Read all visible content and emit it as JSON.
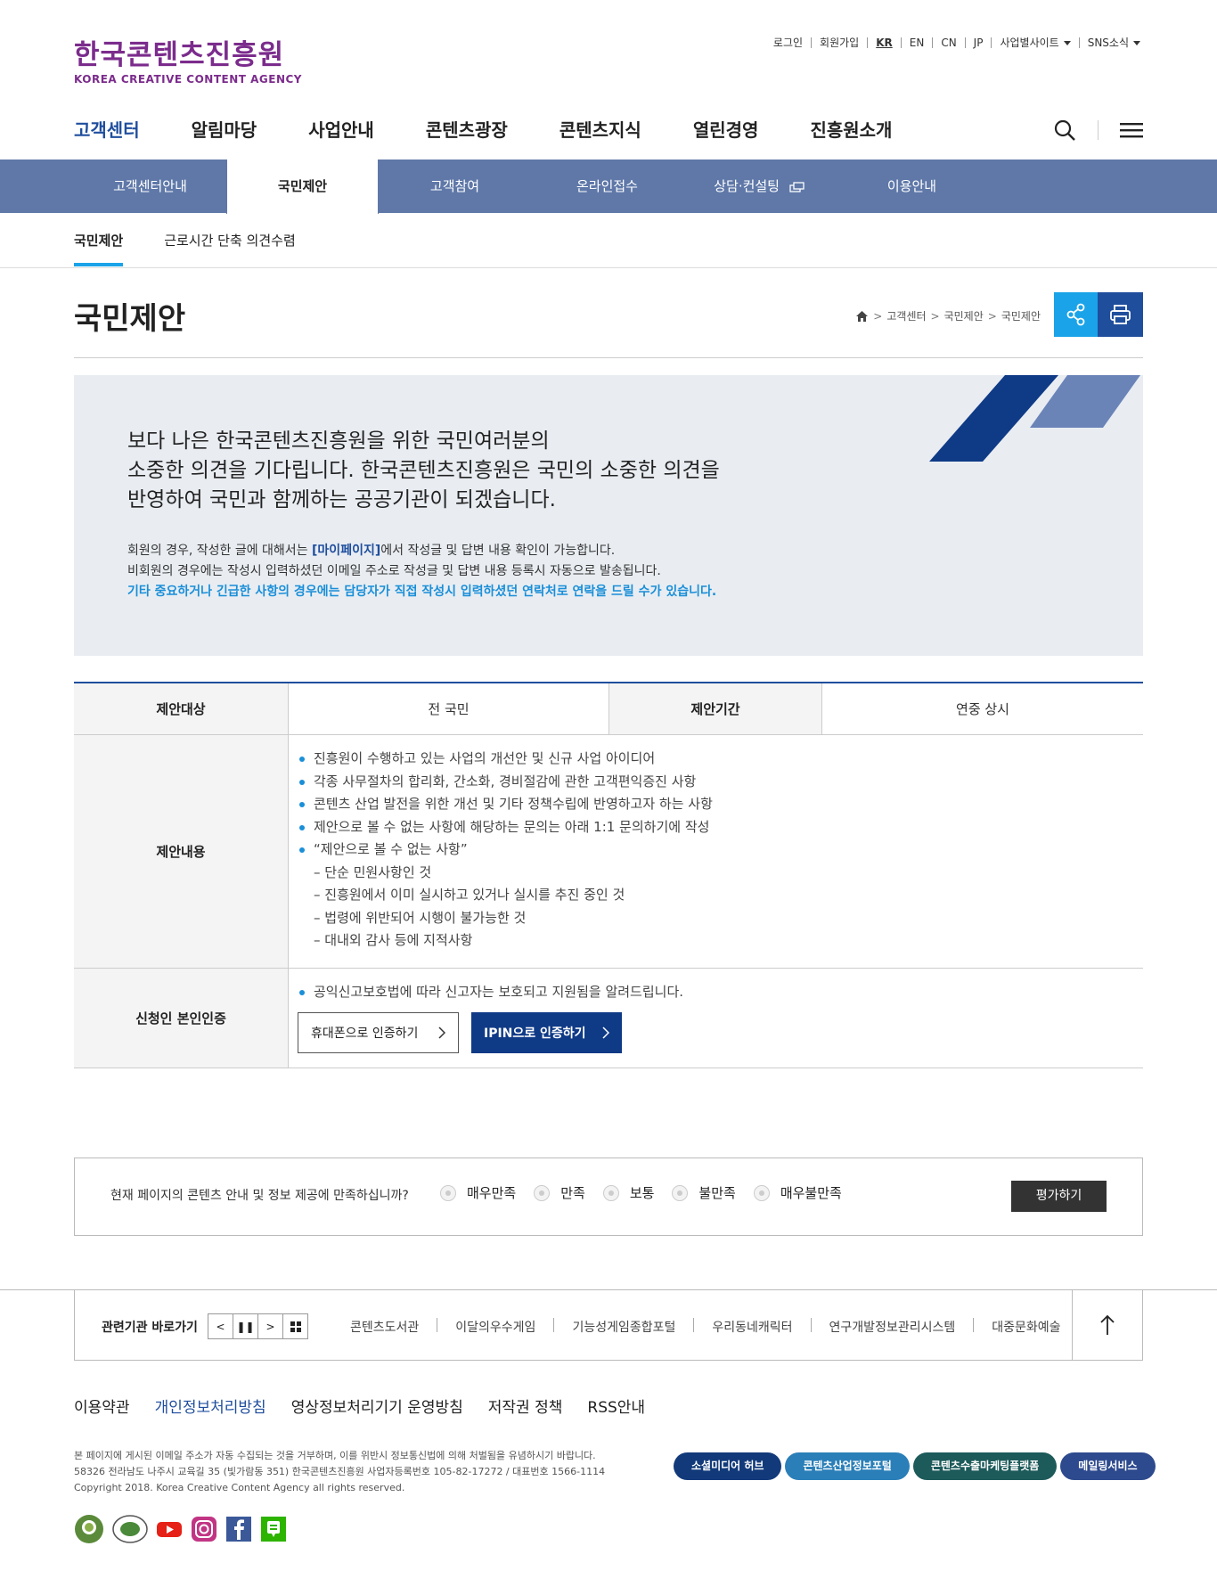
{
  "logo": {
    "ko": "한국콘텐츠진흥원",
    "en": "KOREA CREATIVE CONTENT AGENCY"
  },
  "util": {
    "login": "로그인",
    "join": "회원가입",
    "langs": [
      "KR",
      "EN",
      "CN",
      "JP"
    ],
    "business_sites": "사업별사이트",
    "sns": "SNS소식"
  },
  "gnb": [
    "고객센터",
    "알림마당",
    "사업안내",
    "콘텐츠광장",
    "콘텐츠지식",
    "열린경영",
    "진흥원소개"
  ],
  "snb": [
    "고객센터안내",
    "국민제안",
    "고객참여",
    "온라인접수",
    "상담·컨설팅",
    "이용안내"
  ],
  "tabs": [
    "국민제안",
    "근로시간 단축 의견수렴"
  ],
  "page_title": "국민제안",
  "breadcrumb": [
    "고객센터",
    "국민제안",
    "국민제안"
  ],
  "intro": {
    "lines": [
      "보다 나은 한국콘텐츠진흥원을 위한 국민여러분의",
      "소중한 의견을 기다립니다. 한국콘텐츠진흥원은 국민의 소중한 의견을",
      "반영하여 국민과 함께하는 공공기관이 되겠습니다."
    ],
    "note1_pre": "회원의 경우, 작성한 글에 대해서는 ",
    "note1_hl": "[마이페이지]",
    "note1_post": "에서 작성글 및 답변 내용 확인이 가능합니다.",
    "note2": "비회원의 경우에는 작성시 입력하셨던 이메일 주소로 작성글 및 답변 내용 등록시 자동으로 발송됩니다.",
    "note3": "기타 중요하거나 긴급한 사항의 경우에는 담당자가 직접 작성시 입력하셨던 연락처로 연락을 드릴 수가 있습니다."
  },
  "table": {
    "target_label": "제안대상",
    "target_value": "전 국민",
    "period_label": "제안기간",
    "period_value": "연중 상시",
    "content_label": "제안내용",
    "content_items": [
      "진흥원이 수행하고 있는 사업의 개선안 및 신규 사업 아이디어",
      "각종 사무절차의 합리화, 간소화, 경비절감에 관한 고객편익증진 사항",
      "콘텐츠 산업 발전을 위한 개선 및 기타 정책수립에 반영하고자 하는 사항",
      "제안으로 볼 수 없는 사항에 해당하는 문의는 아래 1:1 문의하기에 작성",
      "“제안으로 볼 수 없는 사항”"
    ],
    "content_subitems": [
      "– 단순 민원사항인 것",
      "– 진흥원에서 이미 실시하고 있거나 실시를 추진 중인 것",
      "– 법령에 위반되어 시행이 불가능한 것",
      "– 대내외 감사 등에 지적사항"
    ],
    "auth_label": "신청인 본인인증",
    "auth_note": "공익신고보호법에 따라 신고자는 보호되고 지원됨을 알려드립니다.",
    "auth_phone": "휴대폰으로 인증하기",
    "auth_ipin": "IPIN으로 인증하기"
  },
  "survey": {
    "question": "현재 페이지의 콘텐츠 안내 및 정보 제공에 만족하십니까?",
    "options": [
      "매우만족",
      "만족",
      "보통",
      "불만족",
      "매우불만족"
    ],
    "submit": "평가하기"
  },
  "related": {
    "label": "관련기관 바로가기",
    "links": [
      "콘텐츠도서관",
      "이달의우수게임",
      "기능성게임종합포털",
      "우리동네캐릭터",
      "연구개발정보관리시스템",
      "대중문화예술"
    ]
  },
  "footer": {
    "links": [
      "이용약관",
      "개인정보처리방침",
      "영상정보처리기기 운영방침",
      "저작권 정책",
      "RSS안내"
    ],
    "info": [
      "본 페이지에 게시된 이메일 주소가 자동 수집되는 것을 거부하며, 이를 위반시 정보통신법에 의해 처벌됨을 유념하시기 바랍니다.",
      "58326 전라남도 나주시 교육길 35 (빛가람동 351) 한국콘텐츠진흥원 사업자등록번호 105-82-17272 / 대표번호 1566-1114",
      "Copyright 2018. Korea Creative Content Agency all rights reserved."
    ],
    "buttons": [
      "소셜미디어 허브",
      "콘텐츠산업정보포털",
      "콘텐츠수출마케팅플랫폼",
      "메일링서비스"
    ],
    "button_colors": [
      "#123a7a",
      "#2a7fb8",
      "#1d5a5a",
      "#2e4a8e"
    ]
  },
  "colors": {
    "primary": "#1f4e9d",
    "accent": "#1aa3e8",
    "logo": "#7b2c8c",
    "snb": "#5f78a8"
  }
}
